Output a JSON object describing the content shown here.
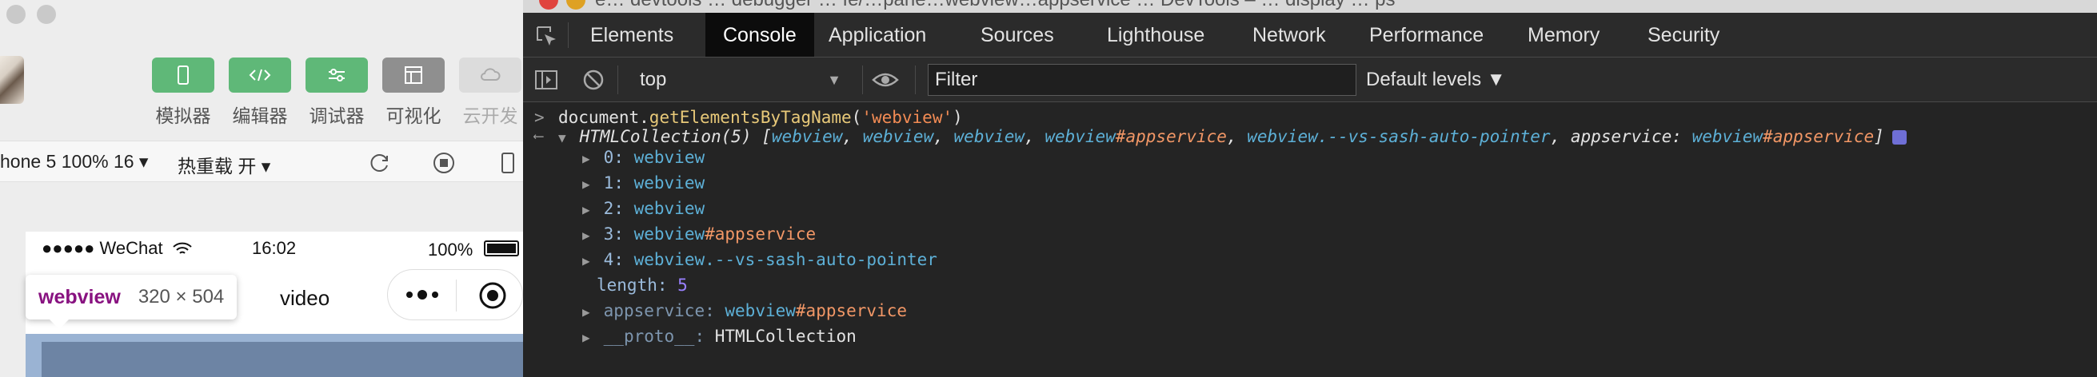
{
  "simulator": {
    "toolbar": {
      "items": [
        {
          "label": "模拟器",
          "icon": "phone-icon"
        },
        {
          "label": "编辑器",
          "icon": "code-icon"
        },
        {
          "label": "调试器",
          "icon": "sliders-icon"
        },
        {
          "label": "可视化",
          "icon": "layout-icon"
        },
        {
          "label": "云开发",
          "icon": "cloud-icon"
        }
      ]
    },
    "device_select": "hone 5 100% 16 ▾",
    "hot_reload": "热重载 开 ▾",
    "status_bar": {
      "carrier": "●●●●● WeChat",
      "time": "16:02",
      "battery": "100%"
    },
    "page_title": "video",
    "tooltip": {
      "tag": "webview",
      "size": "320 × 504"
    }
  },
  "devtools": {
    "title_fragment": "e… devtools … debugger … fe/…pane…webview…appservice … DevTools – … display … ps",
    "tabs": [
      "Elements",
      "Console",
      "Application",
      "Sources",
      "Lighthouse",
      "Network",
      "Performance",
      "Memory",
      "Security"
    ],
    "active_tab": "Console",
    "context": "top",
    "filter_placeholder": "Filter",
    "levels": "Default levels ▼",
    "console": {
      "input": {
        "prefix": "document.",
        "fn": "getElementsByTagName",
        "open": "(",
        "arg": "'webview'",
        "close": ")"
      },
      "result_head": "HTMLCollection(5)",
      "summary": [
        {
          "b": "webview",
          "o": ""
        },
        {
          "b": "webview",
          "o": ""
        },
        {
          "b": "webview",
          "o": ""
        },
        {
          "b": "webview",
          "o": "#appservice"
        },
        {
          "b": "webview.--vs-sash-auto-pointer",
          "o": ""
        }
      ],
      "summary_named": {
        "key": "appservice",
        "b": "webview",
        "o": "#appservice"
      },
      "entries": [
        {
          "index": "0",
          "b": "webview",
          "o": ""
        },
        {
          "index": "1",
          "b": "webview",
          "o": ""
        },
        {
          "index": "2",
          "b": "webview",
          "o": ""
        },
        {
          "index": "3",
          "b": "webview",
          "o": "#appservice"
        },
        {
          "index": "4",
          "b": "webview.--vs-sash-auto-pointer",
          "o": ""
        }
      ],
      "length_key": "length",
      "length_value": "5",
      "named_entry": {
        "key": "appservice",
        "b": "webview",
        "o": "#appservice"
      },
      "proto": {
        "key": "__proto__",
        "value": "HTMLCollection"
      }
    }
  }
}
